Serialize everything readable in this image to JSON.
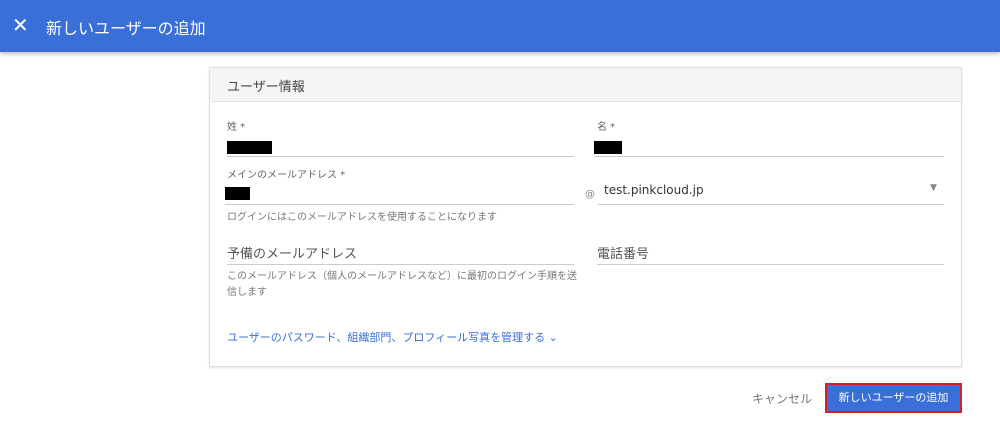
{
  "header": {
    "title": "新しいユーザーの追加",
    "close_icon": "close-icon"
  },
  "section": {
    "title": "ユーザー情報"
  },
  "fields": {
    "last_name_label": "姓 *",
    "first_name_label": "名 *",
    "primary_email_label": "メインのメールアドレス *",
    "at": "@",
    "domain": "test.pinkcloud.jp",
    "primary_email_help": "ログインにはこのメールアドレスを使用することになります",
    "secondary_email_placeholder": "予備のメールアドレス",
    "secondary_email_help": "このメールアドレス（個人のメールアドレスなど）に最初のログイン手順を送信します",
    "phone_placeholder": "電話番号"
  },
  "more_link": "ユーザーのパスワード、組織部門、プロフィール写真を管理する",
  "actions": {
    "cancel": "キャンセル",
    "add": "新しいユーザーの追加"
  }
}
